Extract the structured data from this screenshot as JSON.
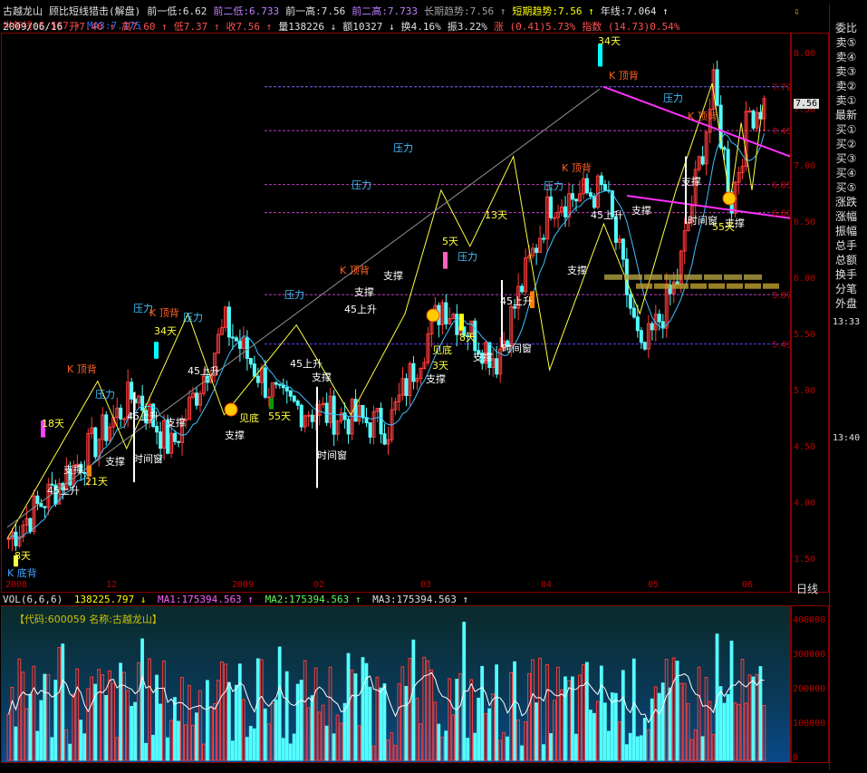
{
  "header": {
    "line1": [
      {
        "text": "古越龙山",
        "color": "#e0e0e0"
      },
      {
        "text": "顾比短线猎击(解盘)",
        "color": "#e0e0e0"
      },
      {
        "text": "前一低:6.62",
        "color": "#e0e0e0"
      },
      {
        "text": "前二低:6.733",
        "color": "#c080ff"
      },
      {
        "text": "前一高:7.56",
        "color": "#e0e0e0"
      },
      {
        "text": "前二高:7.733",
        "color": "#c080ff"
      },
      {
        "text": "长期趋势:7.56 ↑",
        "color": "#a0a0a0"
      },
      {
        "text": "短期趋势:7.56 ↑",
        "color": "#ffff00"
      },
      {
        "text": "年线:7.064 ↑",
        "color": "#e0e0e0"
      },
      {
        "text": "半年线:5.567 ↑",
        "color": "#ff3030"
      },
      {
        "text": "MA3:7.175",
        "color": "#3070ff"
      }
    ],
    "line2": [
      {
        "text": "2009/06/16",
        "color": "#e0e0e0"
      },
      {
        "text": "开7.40 ↑",
        "color": "#ff5050"
      },
      {
        "text": "高7.60 ↑",
        "color": "#ff5050"
      },
      {
        "text": "低7.37 ↑",
        "color": "#ff5050"
      },
      {
        "text": "收7.56 ↑",
        "color": "#ff5050"
      },
      {
        "text": "量138226 ↓",
        "color": "#e0e0e0"
      },
      {
        "text": "额10327 ↓",
        "color": "#e0e0e0"
      },
      {
        "text": "换4.16%",
        "color": "#e0e0e0"
      },
      {
        "text": "振3.22%",
        "color": "#e0e0e0"
      },
      {
        "text": "涨 (0.41)5.73%",
        "color": "#ff5050"
      },
      {
        "text": "指数 (14.73)0.54%",
        "color": "#ff5050"
      }
    ]
  },
  "price_axis": [
    "8.00",
    "7.50",
    "7.00",
    "6.50",
    "6.00",
    "5.50",
    "5.00",
    "4.50",
    "4.00",
    "3.50"
  ],
  "price_markers": [
    "7.72",
    "7.56",
    "6.85",
    "6.60",
    "5.87",
    "5.43",
    "7.45"
  ],
  "time_axis": [
    "2008",
    "12",
    "2009",
    "02",
    "03",
    "04",
    "05",
    "06"
  ],
  "side_panel": {
    "items": [
      "委比",
      "卖⑤",
      "卖④",
      "卖③",
      "卖②",
      "卖①",
      "最新",
      "买①",
      "买②",
      "买③",
      "买④",
      "买⑤",
      "涨跌",
      "涨幅",
      "振幅",
      "总手",
      "总额",
      "换手",
      "分笔",
      "外盘"
    ],
    "time1": "13:33",
    "time2": "13:40",
    "day_line": "日线"
  },
  "annotations": {
    "pressure": "压力",
    "support": "支撑",
    "time_window": "时间窗",
    "rise45": "45上升",
    "top_divergence": "K 顶背",
    "bottom_divergence": "K 底背",
    "see_bottom": "见底",
    "days": [
      "34天",
      "21天",
      "13天",
      "8天",
      "5天",
      "3天",
      "55天",
      "18天"
    ]
  },
  "volume": {
    "title": "VOL(6,6,6)",
    "value": "138225.797 ↓",
    "ma1": "MA1:175394.563 ↑",
    "ma2": "MA2:175394.563 ↑",
    "ma3": "MA3:175394.563 ↑",
    "code_label": "【代码:600059 名称:古越龙山】",
    "axis": [
      "400000",
      "300000",
      "200000",
      "100000",
      "0"
    ]
  },
  "colors": {
    "up": "#ff3c3c",
    "down": "#54ffff",
    "grid": "#8b0000",
    "axis_text": "#c00000"
  }
}
